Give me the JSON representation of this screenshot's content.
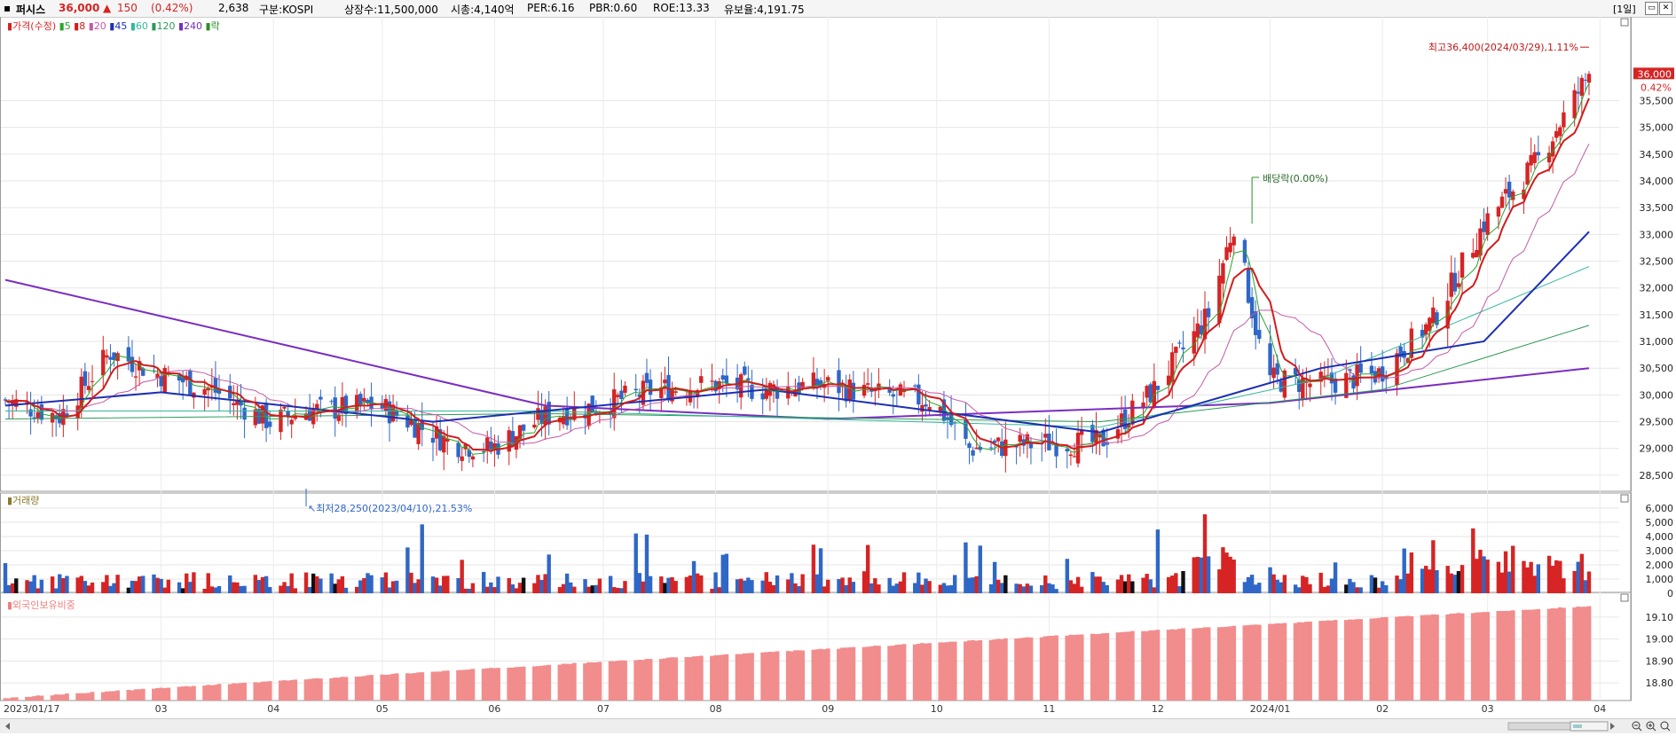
{
  "header": {
    "stock_name": "퍼시스",
    "price": "36,000",
    "change_arrow": "▲",
    "change": "150",
    "change_pct": "(0.42%)",
    "volume": "2,638",
    "market": "구분:KOSPI",
    "shares": "상장수:11,500,000",
    "market_cap": "시총:4,140억",
    "per": "PER:6.16",
    "pbr": "PBR:0.60",
    "roe": "ROE:13.33",
    "reserve": "유보율:4,191.75",
    "period": "[1일]",
    "min_icon": "minimize-icon",
    "close_icon": "close-icon"
  },
  "legend": {
    "price_label": "가격(수정)",
    "ma": [
      "5",
      "8",
      "20",
      "45",
      "60",
      "120",
      "240"
    ],
    "ex_label": "락"
  },
  "colors": {
    "up": "#d62424",
    "down": "#2f67c6",
    "ma5": "#2aa52a",
    "ma8": "#d11c1c",
    "ma20": "#c45aa8",
    "ma45": "#1c2fb3",
    "ma60": "#33b89c",
    "ma120": "#2c9a58",
    "ma240": "#7a2ec0",
    "foreign": "#f28d8d"
  },
  "chart_data": [
    {
      "type": "candlestick",
      "title": "퍼시스",
      "x_range": [
        "2023/01/17",
        "2024/03/29"
      ],
      "month_labels": [
        "2023/01/17",
        "03",
        "04",
        "05",
        "06",
        "07",
        "08",
        "09",
        "10",
        "11",
        "12",
        "2024/01",
        "02",
        "03",
        "04"
      ],
      "ylim": [
        28200,
        36900
      ],
      "y_ticks": [
        28500,
        29000,
        29500,
        30000,
        30500,
        31000,
        31500,
        32000,
        32500,
        33000,
        33500,
        34000,
        34500,
        35000,
        35500
      ],
      "current_price": "36,000",
      "current_pct": "0.42%",
      "high_annotation": "최고36,400(2024/03/29),1.11%",
      "high_value": 36400,
      "low_annotation": "최저28,250(2023/04/10),21.53%",
      "low_value": 28250,
      "dividend_annotation": "배당락(0.00%)",
      "dividend_date": "2023/12/27",
      "close_path": [
        {
          "date": "2023/01/17",
          "close": 29900
        },
        {
          "date": "2023/02/01",
          "close": 29600
        },
        {
          "date": "2023/02/15",
          "close": 30800
        },
        {
          "date": "2023/02/28",
          "close": 30400
        },
        {
          "date": "2023/03/15",
          "close": 30100
        },
        {
          "date": "2023/03/31",
          "close": 29500
        },
        {
          "date": "2023/04/10",
          "close": 29700
        },
        {
          "date": "2023/04/30",
          "close": 29800
        },
        {
          "date": "2023/05/20",
          "close": 29100
        },
        {
          "date": "2023/05/31",
          "close": 29000
        },
        {
          "date": "2023/06/15",
          "close": 29600
        },
        {
          "date": "2023/06/30",
          "close": 29800
        },
        {
          "date": "2023/07/15",
          "close": 30100
        },
        {
          "date": "2023/07/31",
          "close": 30200
        },
        {
          "date": "2023/08/15",
          "close": 30100
        },
        {
          "date": "2023/08/31",
          "close": 30200
        },
        {
          "date": "2023/09/15",
          "close": 30000
        },
        {
          "date": "2023/09/30",
          "close": 29900
        },
        {
          "date": "2023/10/10",
          "close": 29000
        },
        {
          "date": "2023/10/31",
          "close": 29100
        },
        {
          "date": "2023/11/15",
          "close": 29100
        },
        {
          "date": "2023/11/30",
          "close": 30100
        },
        {
          "date": "2023/12/15",
          "close": 31500
        },
        {
          "date": "2023/12/22",
          "close": 33200
        },
        {
          "date": "2023/12/31",
          "close": 30300
        },
        {
          "date": "2024/01/15",
          "close": 30200
        },
        {
          "date": "2024/01/31",
          "close": 30400
        },
        {
          "date": "2024/02/15",
          "close": 31400
        },
        {
          "date": "2024/02/29",
          "close": 33200
        },
        {
          "date": "2024/03/15",
          "close": 34400
        },
        {
          "date": "2024/03/29",
          "close": 36000
        }
      ],
      "moving_averages": {
        "ma240": [
          {
            "date": "2023/01/17",
            "v": 32150
          },
          {
            "date": "2023/06/15",
            "v": 29800
          },
          {
            "date": "2023/09/01",
            "v": 29550
          },
          {
            "date": "2024/01/01",
            "v": 29850
          },
          {
            "date": "2024/03/29",
            "v": 30500
          }
        ],
        "ma45": [
          {
            "date": "2023/01/17",
            "v": 29800
          },
          {
            "date": "2023/03/01",
            "v": 30050
          },
          {
            "date": "2023/05/15",
            "v": 29500
          },
          {
            "date": "2023/08/15",
            "v": 30100
          },
          {
            "date": "2023/11/15",
            "v": 29300
          },
          {
            "date": "2024/01/15",
            "v": 30500
          },
          {
            "date": "2024/02/29",
            "v": 31000
          },
          {
            "date": "2024/03/29",
            "v": 33050
          }
        ],
        "ma120": [
          {
            "date": "2023/01/17",
            "v": 29550
          },
          {
            "date": "2023/06/15",
            "v": 29650
          },
          {
            "date": "2023/11/15",
            "v": 29500
          },
          {
            "date": "2024/02/01",
            "v": 30100
          },
          {
            "date": "2024/03/29",
            "v": 31300
          }
        ],
        "ma60": [
          {
            "date": "2023/01/17",
            "v": 29700
          },
          {
            "date": "2023/06/15",
            "v": 29700
          },
          {
            "date": "2023/11/15",
            "v": 29400
          },
          {
            "date": "2024/01/15",
            "v": 30300
          },
          {
            "date": "2024/03/29",
            "v": 32400
          }
        ]
      }
    },
    {
      "type": "bar",
      "title": "거래량",
      "y_ticks": [
        0,
        1000,
        2000,
        3000,
        4000,
        5000,
        6000
      ],
      "ylim": [
        0,
        6500
      ]
    },
    {
      "type": "bar",
      "title": "외국인보유비중",
      "y_ticks": [
        18.8,
        18.9,
        19.0,
        19.1
      ],
      "y_tick_labels": [
        "18.80",
        "18.90",
        "19.00",
        "19.10"
      ],
      "ylim": [
        18.72,
        19.18
      ],
      "start_value": 18.73,
      "end_value": 19.15
    }
  ],
  "footer": {
    "zoom_out_icon": "zoom-out-icon",
    "zoom_in_icon": "zoom-in-icon",
    "zoom_reset_icon": "zoom-reset-icon",
    "left_arrow_icon": "scroll-left-icon",
    "right_arrow_icon": "scroll-right-icon"
  }
}
